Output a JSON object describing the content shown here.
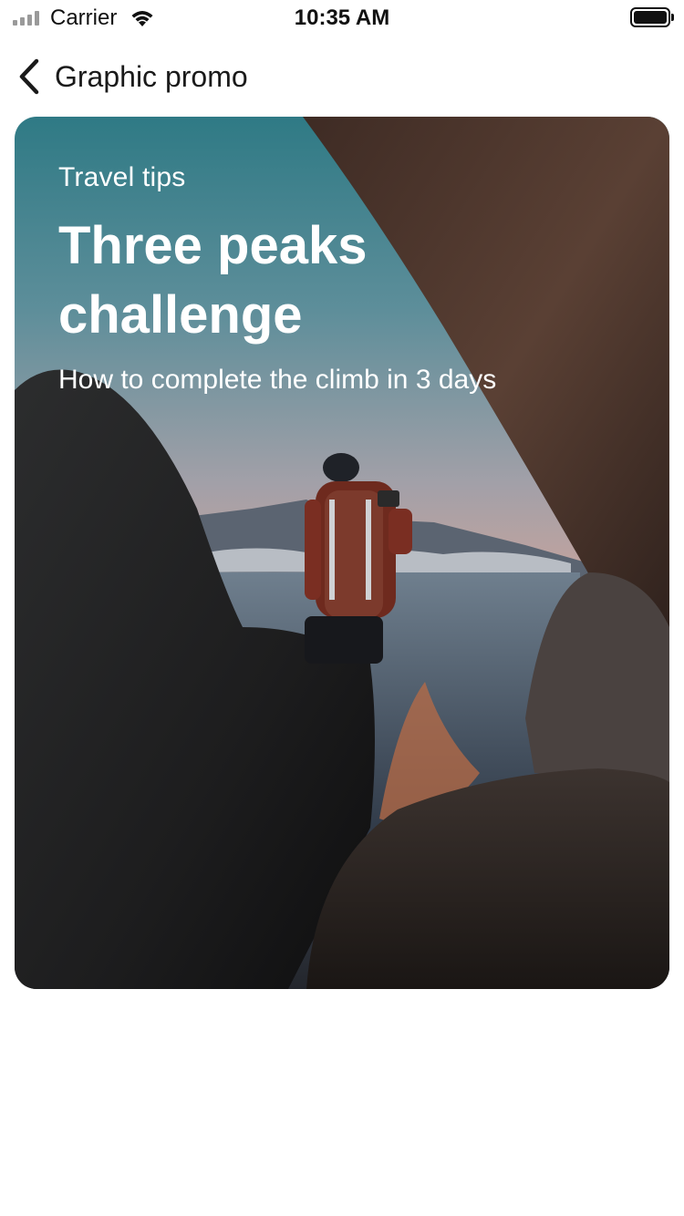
{
  "status_bar": {
    "carrier": "Carrier",
    "time": "10:35 AM",
    "icons": [
      "signal-icon",
      "wifi-icon",
      "battery-icon"
    ]
  },
  "nav": {
    "title": "Graphic promo",
    "back_icon": "chevron-left-icon"
  },
  "promo": {
    "eyebrow": "Travel tips",
    "headline_line1": "Three peaks",
    "headline_line2": "challenge",
    "subhead": "How to complete the climb in 3 days",
    "image_subject": "hiker-on-rocks-photo"
  },
  "colors": {
    "text_on_image": "#ffffff",
    "nav_text": "#1a1a1a",
    "background": "#ffffff"
  }
}
